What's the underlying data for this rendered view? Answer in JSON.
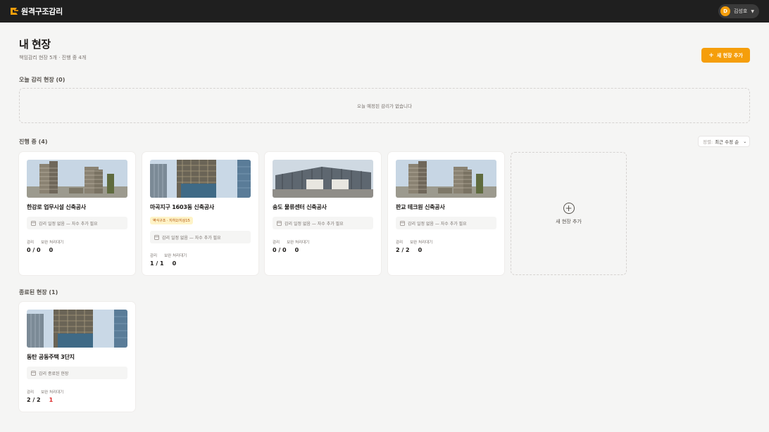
{
  "app": {
    "logo_text": "원격구조감리",
    "user_initial": "D",
    "user_name": "김성호"
  },
  "header": {
    "title": "내 현장",
    "subtitle": "책임감리 현장 5개 · 진행 중 4개",
    "add_button": "새 현장 추가"
  },
  "today": {
    "title": "오늘 감리 현장 (0)",
    "empty": "오늘 예정된 감리가 없습니다"
  },
  "in_progress": {
    "title": "진행 중 (4)",
    "sort_label": "정렬:",
    "sort_value": "최근 수정 순",
    "cards": [
      {
        "title": "한강로 업무시설 신축공사",
        "note": "감리 일정 없음 — 자수 추가 필요",
        "stat1_label": "감리",
        "stat2_label": "보완 처리대기",
        "stat1_value": "0 / 0",
        "stat2_value": "0"
      },
      {
        "title": "마곡지구 1603동 신축공사",
        "tag": "벽식구조 · 지하2/지상15",
        "note": "감리 일정 없음 — 자수 추가 필요",
        "stat1_label": "감리",
        "stat2_label": "보완 처리대기",
        "stat1_value": "1 / 1",
        "stat2_value": "0"
      },
      {
        "title": "송도 물류센터 신축공사",
        "note": "감리 일정 없음 — 자수 추가 필요",
        "stat1_label": "감리",
        "stat2_label": "보완 처리대기",
        "stat1_value": "0 / 0",
        "stat2_value": "0"
      },
      {
        "title": "판교 테크원 신축공사",
        "note": "감리 일정 없음 — 자수 추가 필요",
        "stat1_label": "감리",
        "stat2_label": "보완 처리대기",
        "stat1_value": "2 / 2",
        "stat2_value": "0"
      }
    ],
    "add_card_label": "새 현장 추가"
  },
  "completed": {
    "title": "종료된 현장 (1)",
    "cards": [
      {
        "title": "동탄 공동주택 3단지",
        "note": "감리 종료된 현장",
        "stat1_label": "감리",
        "stat2_label": "보완 처리대기",
        "stat1_value": "2 / 2",
        "stat2_value": "1"
      }
    ]
  },
  "colors": {
    "accent": "#f59e0b",
    "topbar": "#1f1f1f",
    "alert": "#dc2626"
  }
}
